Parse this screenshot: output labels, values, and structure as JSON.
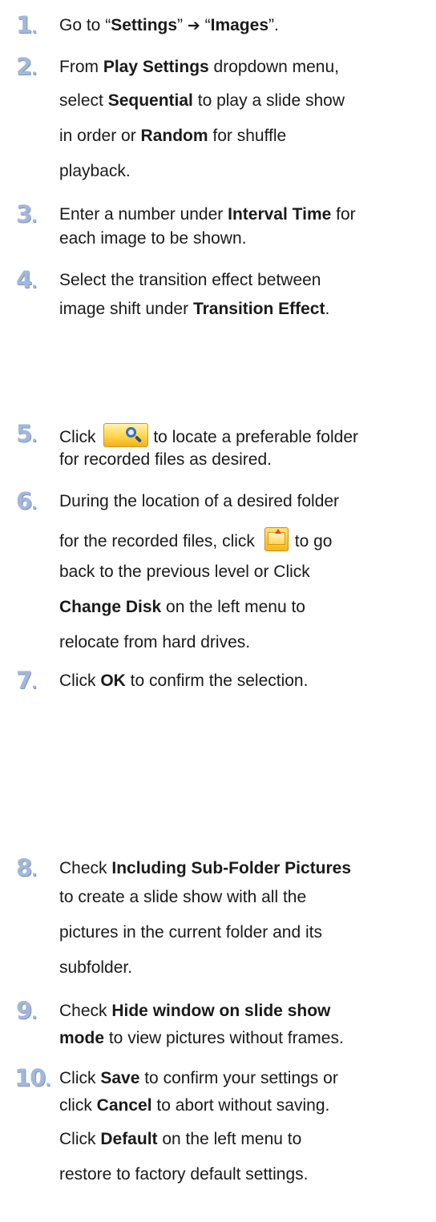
{
  "steps": [
    {
      "number": "1",
      "lines": [
        {
          "pre": "Go to “",
          "b1": "Settings",
          "mid": "” ",
          "arrow": "➔",
          "mid2": " “",
          "b2": "Images",
          "post": "”."
        }
      ]
    },
    {
      "number": "2",
      "lines": [
        {
          "pre": "From ",
          "b1": "Play Settings",
          "post": " dropdown menu,"
        },
        {
          "pre": "select ",
          "b1": "Sequential",
          "post": " to play a slide show"
        },
        {
          "pre": "in order or ",
          "b1": "Random",
          "post": " for shuffle"
        },
        {
          "pre": "playback."
        }
      ]
    },
    {
      "number": "3",
      "lines": [
        {
          "pre": "Enter a number under ",
          "b1": "Interval Time",
          "post": " for"
        },
        {
          "pre": "each image to be shown."
        }
      ]
    },
    {
      "number": "4",
      "lines": [
        {
          "pre": "Select the transition effect between"
        },
        {
          "pre": "image shift under ",
          "b1": "Transition Effect",
          "post": "."
        }
      ]
    },
    {
      "number": "5",
      "lines": [
        {
          "pre": "Click ",
          "icon": "browse-icon",
          "post": "to locate a preferable folder"
        },
        {
          "pre": "for recorded files as desired."
        }
      ]
    },
    {
      "number": "6",
      "lines": [
        {
          "pre": "During the location of a desired folder"
        },
        {
          "pre": "for the recorded files, click ",
          "icon": "folder-up-icon",
          "post": "to go"
        },
        {
          "pre": "back to the previous level or Click"
        },
        {
          "b1": "Change Disk",
          "post": " on the left menu to"
        },
        {
          "pre": "relocate from hard drives."
        }
      ]
    },
    {
      "number": "7",
      "lines": [
        {
          "pre": "Click ",
          "b1": "OK",
          "post": " to confirm the selection."
        }
      ]
    },
    {
      "number": "8",
      "lines": [
        {
          "pre": "Check ",
          "b1": "Including Sub-Folder Pictures"
        },
        {
          "pre": "to create a slide show with all the"
        },
        {
          "pre": "pictures in the current folder and its"
        },
        {
          "pre": "subfolder."
        }
      ]
    },
    {
      "number": "9",
      "lines": [
        {
          "pre": "Check ",
          "b1": "Hide window on slide show"
        },
        {
          "b1": "mode",
          "post": " to view pictures without frames."
        }
      ]
    },
    {
      "number": "10",
      "lines": [
        {
          "pre": "Click ",
          "b1": "Save",
          "post": " to confirm your settings or"
        },
        {
          "pre": "click ",
          "b1": "Cancel",
          "post": " to abort without saving."
        },
        {
          "pre": "Click ",
          "b1": "Default",
          "post": " on the left menu to"
        },
        {
          "pre": "restore to factory default settings."
        }
      ]
    }
  ],
  "colors": {
    "step_number": "#a3b8d8",
    "text": "#1a1a1a"
  }
}
